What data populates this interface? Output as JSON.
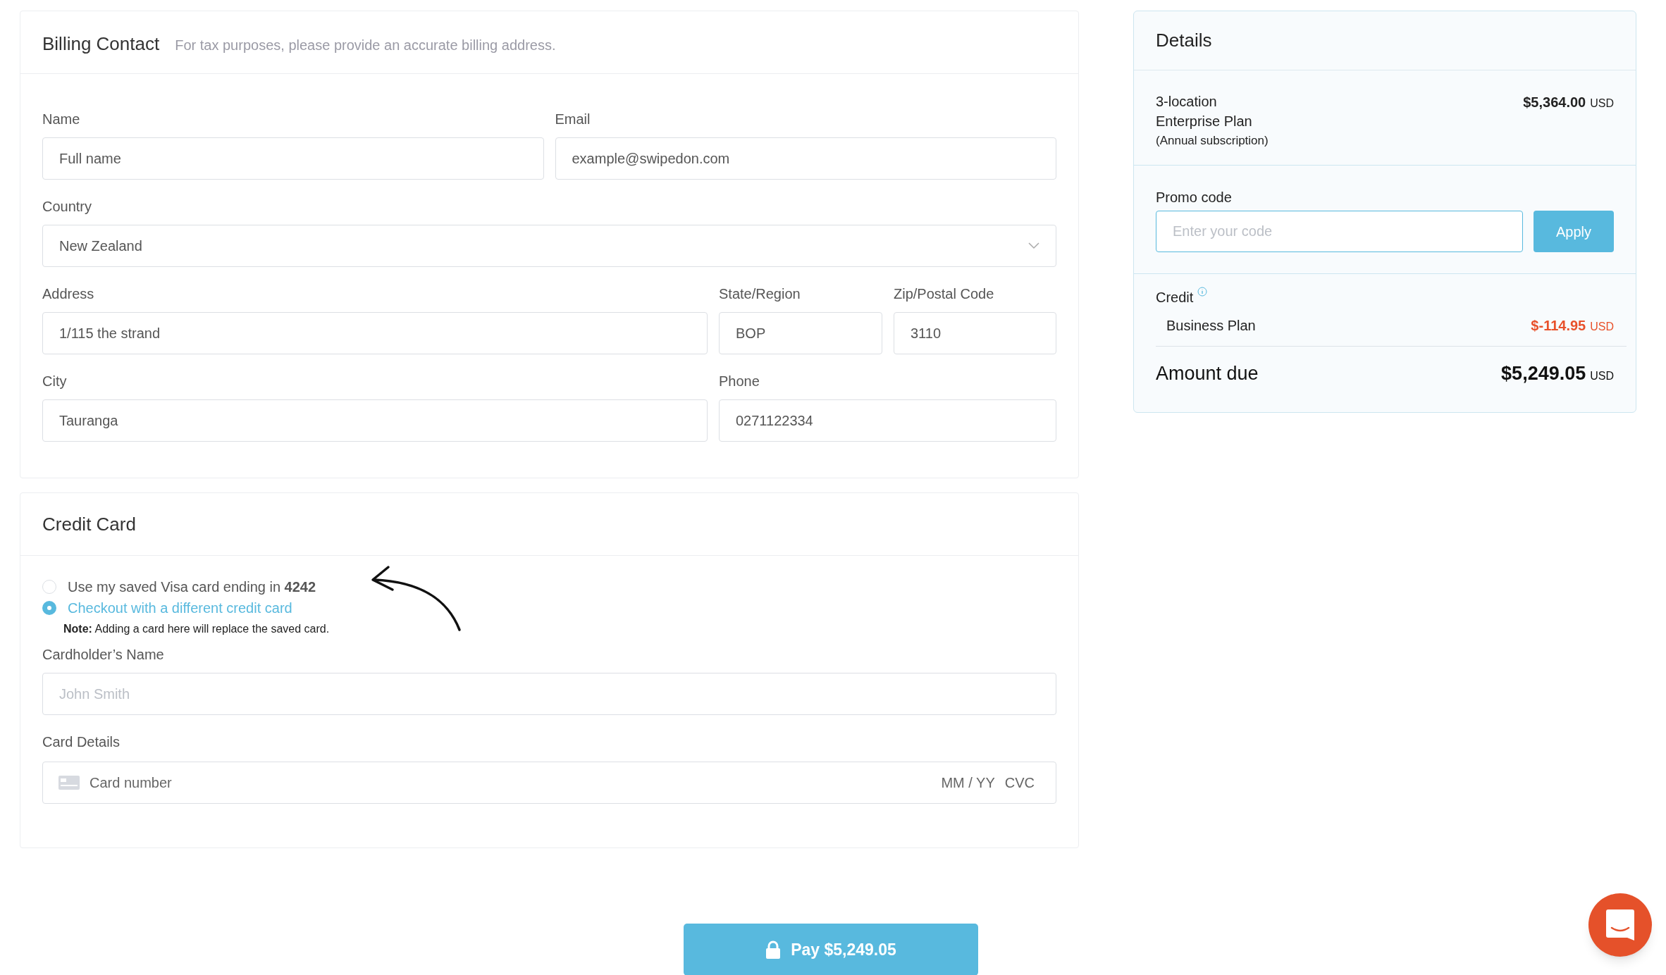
{
  "billing": {
    "title": "Billing Contact",
    "subtitle": "For tax purposes, please provide an accurate billing address.",
    "rows": [
      [
        {
          "label": "Name",
          "placeholder": "Full name",
          "kind": "text"
        },
        {
          "label": "Email",
          "placeholder": "example@swipedon.com",
          "kind": "text"
        }
      ],
      [
        {
          "label": "Country",
          "value": "New Zealand",
          "kind": "select"
        }
      ],
      [
        {
          "label": "Address",
          "value": "1/115 the strand",
          "kind": "text"
        },
        {
          "label": "State/Region",
          "value": "BOP",
          "kind": "text"
        },
        {
          "label": "Zip/Postal Code",
          "value": "3110",
          "kind": "text"
        }
      ],
      [
        {
          "label": "City",
          "value": "Tauranga",
          "kind": "text"
        },
        {
          "label": "Phone",
          "value": "0271122334",
          "kind": "text"
        }
      ]
    ]
  },
  "credit_card": {
    "title": "Credit Card",
    "options": [
      {
        "label": "Use my saved Visa card ending in **4242**",
        "selected": false
      },
      {
        "label": "Checkout with a different credit card",
        "selected": true
      }
    ],
    "note": "**Note:** Adding a card here will replace the saved card.",
    "cardholder": {
      "label": "Cardholder’s Name",
      "placeholder": "John Smith"
    },
    "card_details": {
      "label": "Card Details",
      "placeholder": "Card number",
      "expiry_placeholder": "MM / YY",
      "cvc_placeholder": "CVC"
    }
  },
  "details": {
    "title": "Details",
    "plan": {
      "lines": [
        "3-location",
        "Enterprise Plan"
      ],
      "note": "(Annual subscription)",
      "amount": "$5,364.00",
      "currency": "USD"
    },
    "promo": {
      "label": "Promo code",
      "placeholder": "Enter your code",
      "button": "Apply"
    },
    "credit": {
      "label": "Credit",
      "items": [
        {
          "name": "Business Plan",
          "amount": "$-114.95",
          "currency": "USD"
        }
      ]
    },
    "total": {
      "label": "Amount due",
      "amount": "$5,249.05",
      "currency": "USD"
    }
  },
  "pay_button": "Pay $5,249.05"
}
